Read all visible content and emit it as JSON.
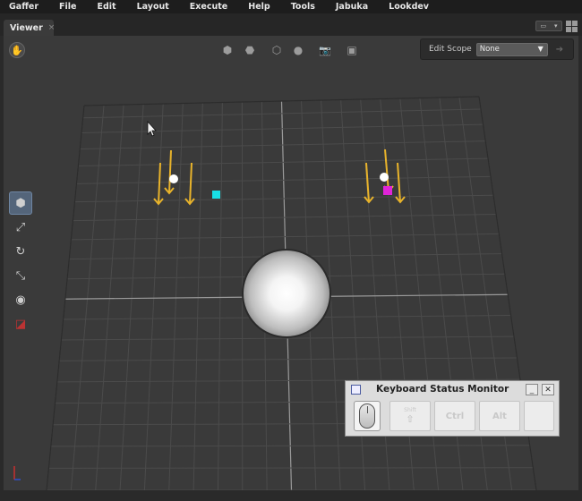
{
  "menubar": {
    "items": [
      "Gaffer",
      "File",
      "Edit",
      "Layout",
      "Execute",
      "Help",
      "Tools",
      "Jabuka",
      "Lookdev"
    ]
  },
  "tabs": [
    {
      "label": "Viewer",
      "close": "×"
    }
  ],
  "toolbar": {
    "edit_scope_label": "Edit Scope",
    "edit_scope_value": "None",
    "edit_scope_arrow": "▼",
    "goto_glyph": "➔"
  },
  "icons": {
    "hand": "✋",
    "expansion": "⬢",
    "selection_mask": "⬣",
    "shading": "⬡",
    "sphere": "●",
    "camera": "📷",
    "display": "▣"
  },
  "tools": [
    {
      "name": "selection-tool",
      "glyph": "⬢",
      "active": true
    },
    {
      "name": "translate-tool",
      "glyph": "⤢",
      "active": false
    },
    {
      "name": "rotate-tool",
      "glyph": "↻",
      "active": false
    },
    {
      "name": "scale-tool",
      "glyph": "⤡",
      "active": false
    },
    {
      "name": "camera-tool",
      "glyph": "◉",
      "active": false
    },
    {
      "name": "crop-window-tool",
      "glyph": "◪",
      "active": false
    }
  ],
  "keyboard_monitor": {
    "title": "Keyboard Status Monitor",
    "minimize": "_",
    "close": "✕",
    "keys": [
      {
        "label": "",
        "sub": "Shift"
      },
      {
        "label": "Ctrl",
        "sub": ""
      },
      {
        "label": "Alt",
        "sub": ""
      },
      {
        "label": "",
        "sub": ""
      }
    ]
  },
  "colors": {
    "light_arrow": "#e8b32b",
    "cyan_light": "#18e0e6",
    "magenta_light": "#e024d8",
    "axis_red": "#c83030",
    "axis_blue": "#3050d0"
  }
}
